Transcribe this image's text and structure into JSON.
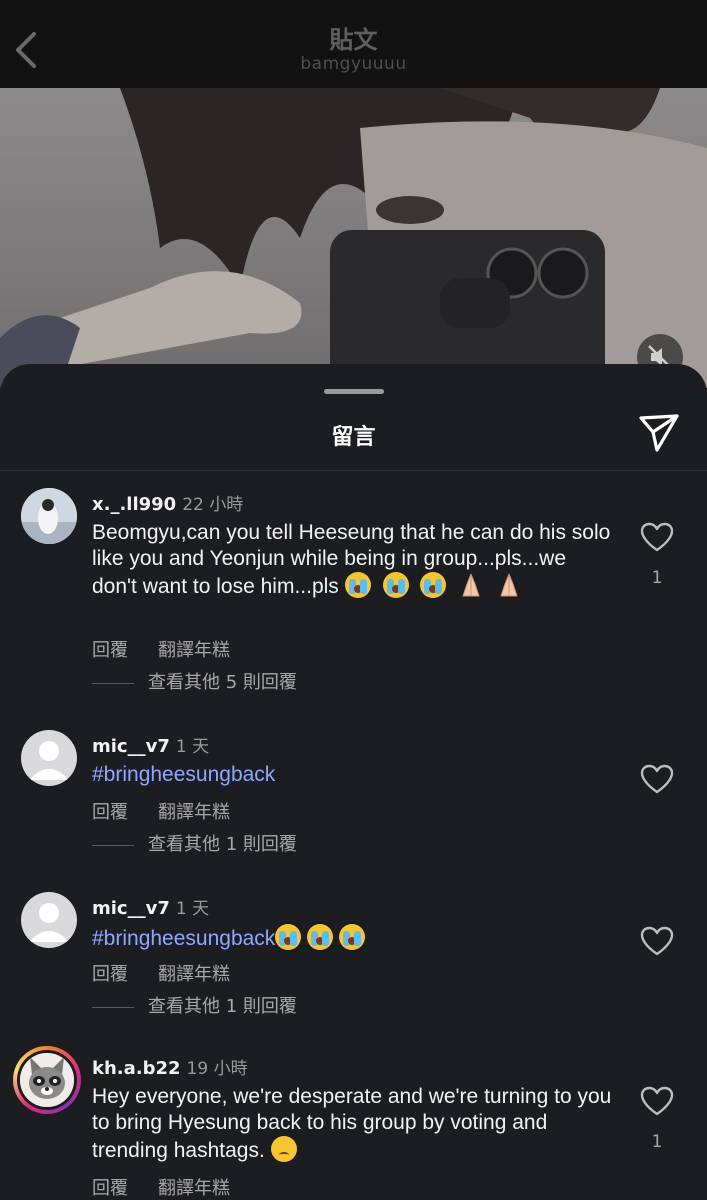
{
  "nav": {
    "title": "貼文",
    "subtitle": "bamgyuuuu"
  },
  "sheet": {
    "title": "留言"
  },
  "comments": [
    {
      "username": "x._.ll990",
      "time": "22 小時",
      "text": "Beomgyu,can you tell Heeseung that he can do his solo like you and Yeonjun while being in group...pls...we don't want to lose him...pls",
      "reply": "回覆",
      "translate": "翻譯年糕",
      "more_replies": "查看其他 5 則回覆",
      "likes": "1",
      "emojis": [
        "loudly-crying-face",
        "loudly-crying-face",
        "loudly-crying-face",
        "folded-hands-icon",
        "folded-hands-icon"
      ]
    },
    {
      "username": "mic__v7",
      "time": "1 天",
      "text": "#bringheesungback",
      "reply": "回覆",
      "translate": "翻譯年糕",
      "more_replies": "查看其他 1 則回覆",
      "likes": ""
    },
    {
      "username": "mic__v7",
      "time": "1 天",
      "text": "#bringheesungback",
      "reply": "回覆",
      "translate": "翻譯年糕",
      "more_replies": "查看其他 1 則回覆",
      "likes": "",
      "emojis": [
        "loudly-crying-face",
        "loudly-crying-face",
        "loudly-crying-face"
      ]
    },
    {
      "username": "kh.a.b22",
      "time": "19 小時",
      "text": "Hey everyone, we're desperate and we're turning to you to bring Hyesung back to his group by voting and trending hashtags.",
      "reply": "回覆",
      "translate": "翻譯年糕",
      "likes": "1",
      "emojis": [
        "disappointed-face"
      ]
    }
  ],
  "colors": {
    "hashtag": "#8ea8ff",
    "background": "#1c1d21",
    "muted_text": "#a8a8a8"
  },
  "icons": [
    "back-chevron-icon",
    "share-send-icon",
    "mute-icon",
    "heart-icon"
  ]
}
